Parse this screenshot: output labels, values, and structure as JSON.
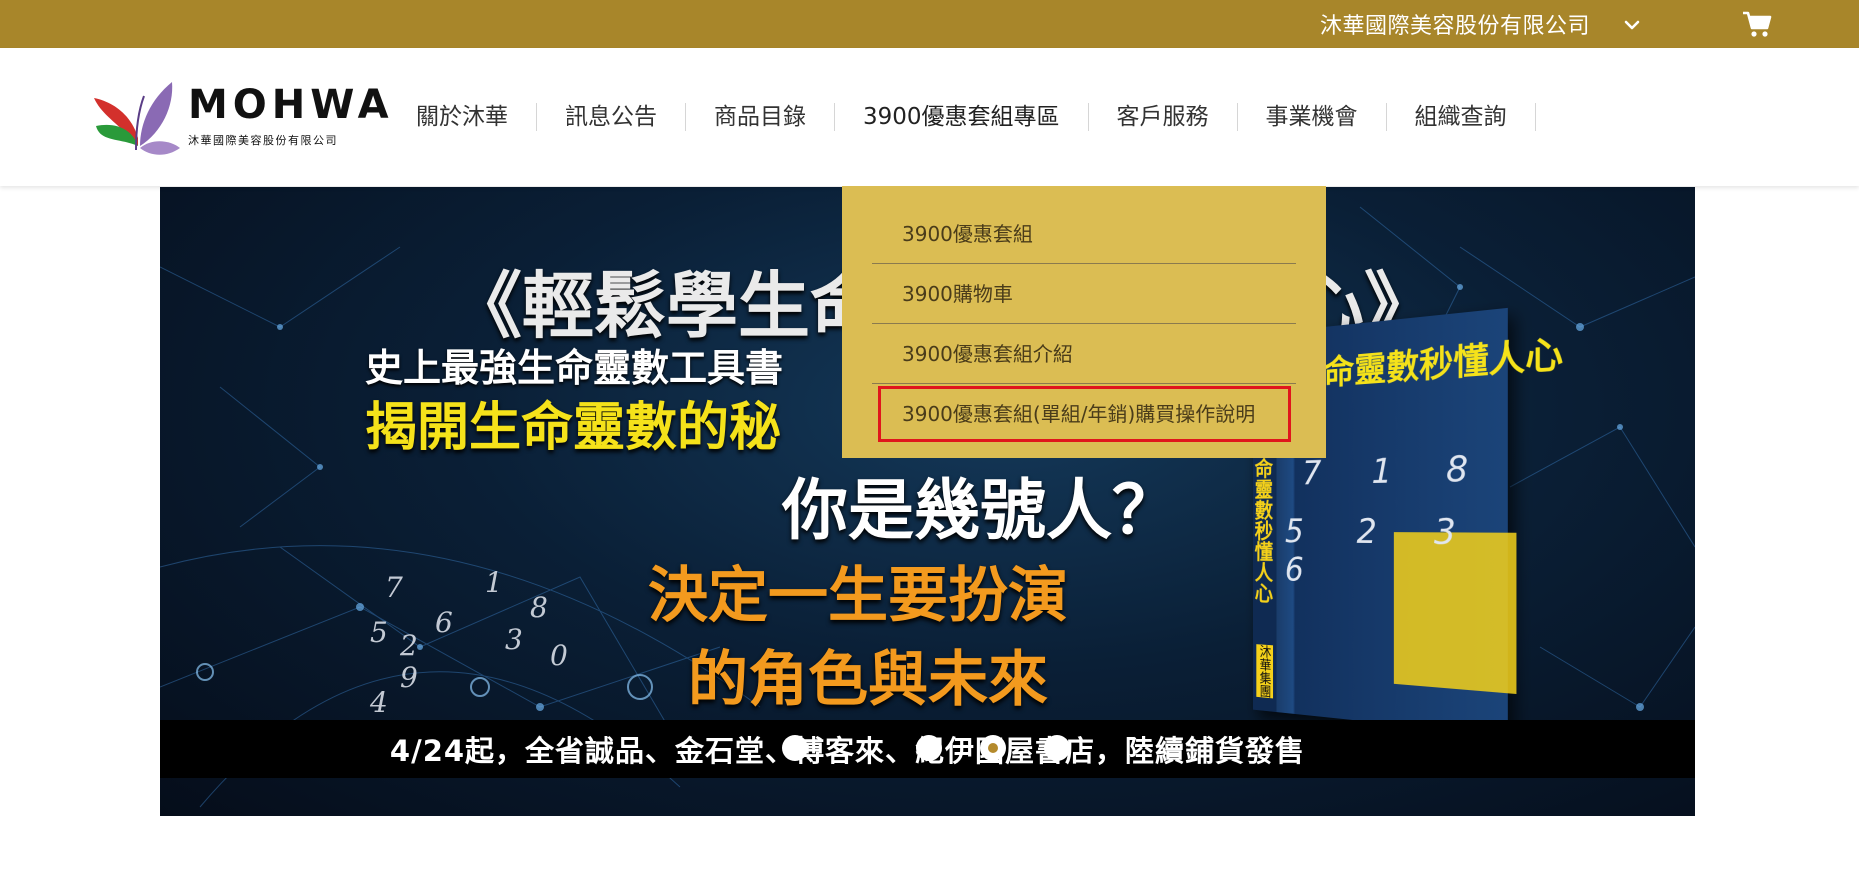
{
  "topbar": {
    "company": "沐華國際美容股份有限公司",
    "chevron_icon": "chevron-down-icon",
    "cart_icon": "cart-icon",
    "bg_color": "#a8862a"
  },
  "header": {
    "logo_text": "MOHWA",
    "logo_subtitle": "沐華國際美容股份有限公司",
    "nav": [
      {
        "label": "關於沐華"
      },
      {
        "label": "訊息公告"
      },
      {
        "label": "商品目錄"
      },
      {
        "label": "3900優惠套組專區"
      },
      {
        "label": "客戶服務"
      },
      {
        "label": "事業機會"
      },
      {
        "label": "組織查詢"
      }
    ]
  },
  "dropdown": {
    "bg_color": "#dbbd53",
    "items": [
      {
        "label": "3900優惠套組"
      },
      {
        "label": "3900購物車"
      },
      {
        "label": "3900優惠套組介紹"
      },
      {
        "label": "3900優惠套組(單組/年銷)購買操作說明"
      }
    ]
  },
  "banner": {
    "title": "《輕鬆學生命",
    "title_end": "心》",
    "line1": "史上最強生命靈數工具書",
    "line2": "揭開生命靈數的秘",
    "question": "你是幾號人？",
    "orange1": "決定一生要扮演",
    "orange2": "的角色與未來",
    "strip": "4/24起，全省誠品、金石堂、博客來、紀伊國屋書店，陸續鋪貨發售",
    "book_title": "學命靈數秒懂人心",
    "book_spine": "生命靈數秒懂人心",
    "book_publisher": "沐華集團",
    "book_nums_1": "7 1 8",
    "book_nums_2": "5 2 3 6",
    "carousel_total": 4,
    "carousel_active": 3
  }
}
